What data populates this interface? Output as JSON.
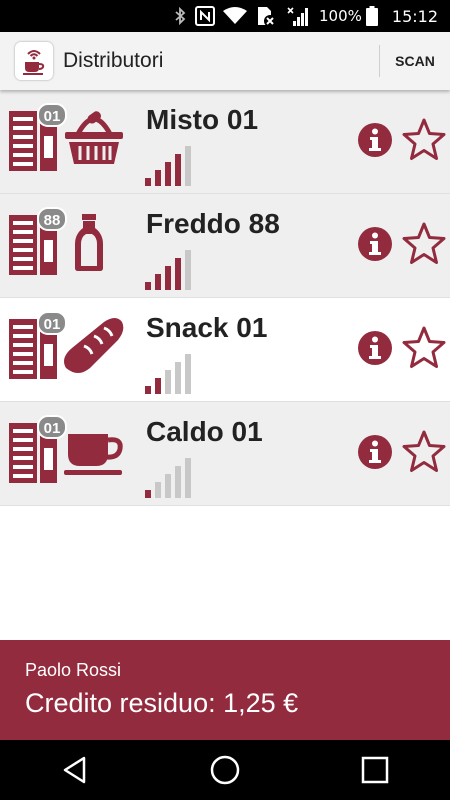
{
  "status_bar": {
    "battery_percent": "100%",
    "time": "15:12",
    "icons": [
      "bluetooth-icon",
      "nfc-icon",
      "wifi-icon",
      "sim-no-signal-icon",
      "cell-signal-icon",
      "battery-icon"
    ]
  },
  "app_bar": {
    "title": "Distributori",
    "scan_label": "SCAN",
    "icon": "vending-wifi-cup-icon"
  },
  "colors": {
    "accent": "#932B3F",
    "badge": "#8A8A8A",
    "signal_inactive": "#C8C8C8",
    "row_shaded": "#EFEFEF"
  },
  "machines": [
    {
      "name": "Misto 01",
      "badge": "01",
      "product_icon": "basket-icon",
      "signal_level": 4,
      "signal_max": 5
    },
    {
      "name": "Freddo 88",
      "badge": "88",
      "product_icon": "bottle-icon",
      "signal_level": 4,
      "signal_max": 5
    },
    {
      "name": "Snack 01",
      "badge": "01",
      "product_icon": "bread-icon",
      "signal_level": 2,
      "signal_max": 5
    },
    {
      "name": "Caldo 01",
      "badge": "01",
      "product_icon": "coffee-cup-icon",
      "signal_level": 1,
      "signal_max": 5
    }
  ],
  "footer": {
    "user_name": "Paolo Rossi",
    "credit_text": "Credito residuo: 1,25 €"
  },
  "nav_bar": {
    "icons": [
      "back-icon",
      "home-icon",
      "recents-icon"
    ]
  }
}
